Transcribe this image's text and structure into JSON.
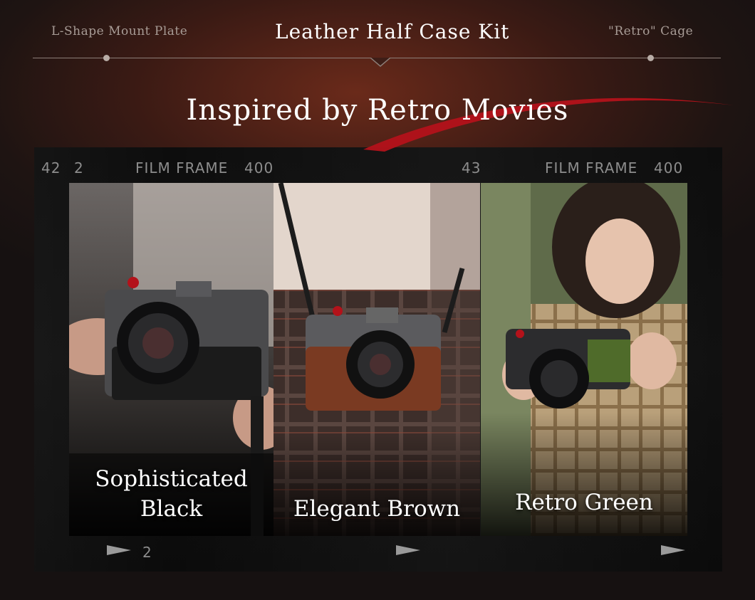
{
  "nav": {
    "left_tab": "L-Shape Mount Plate",
    "active_tab": "Leather Half Case Kit",
    "right_tab": "\"Retro\" Cage"
  },
  "headline": "Inspired by Retro Movies",
  "film_strip": {
    "top_left_num1": "42",
    "top_left_num2": "2",
    "left_frame_text": "FILM FRAME",
    "left_frame_iso": "400",
    "mid_num": "43",
    "right_frame_text": "FILM FRAME",
    "right_frame_iso": "400",
    "bottom_num": "2"
  },
  "frames": [
    {
      "line1": "Sophisticated",
      "line2": "Black",
      "case_color": "black"
    },
    {
      "label": "Elegant Brown",
      "case_color": "brown"
    },
    {
      "label": "Retro Green",
      "case_color": "green"
    }
  ],
  "colors": {
    "accent_red": "#b3121a",
    "brown_case": "#7a3a22",
    "green_case": "#4f6b2a",
    "black_case": "#1b1b1b"
  },
  "icons": {
    "nav_dot": "dot-icon",
    "nav_caret": "caret-down-icon",
    "film_arrow": "triangle-right-icon"
  }
}
